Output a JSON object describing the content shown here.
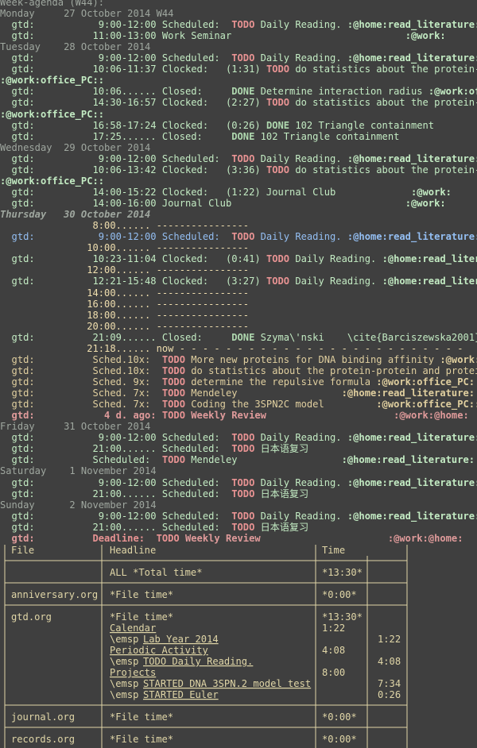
{
  "colors": {
    "background": "#3f3f3f",
    "default": "#dcdccc",
    "gray": "#9fa79f",
    "green": "#c3ebc3",
    "orange_todo": "#e89393",
    "done": "#afd8af",
    "time_pink": "#cc9393",
    "today_blue": "#94bff3",
    "deadline": "#e09b9b",
    "sched_past": "#e0cf9f",
    "line_yellow": "#f0dfaf",
    "table": "#e0d6a7"
  },
  "header": "Week-agenda (W44):",
  "lines": [
    {
      "segs": [
        {
          "t": "Monday     27 October 2014 W44",
          "c": "gray"
        }
      ]
    },
    {
      "segs": [
        {
          "t": "  gtd:           9:00-12:00 Scheduled:  ",
          "c": "green"
        },
        {
          "t": "TODO",
          "c": "orange_todo",
          "b": 1
        },
        {
          "t": " Daily Reading. ",
          "c": "green"
        },
        {
          "t": ":@home:read_literature:",
          "c": "green",
          "b": 1
        }
      ]
    },
    {
      "segs": [
        {
          "t": "  gtd:          11:00-13:00 Work Seminar                              ",
          "c": "green"
        },
        {
          "t": ":@work:",
          "c": "green",
          "b": 1
        }
      ]
    },
    {
      "segs": [
        {
          "t": "Tuesday    28 October 2014",
          "c": "gray"
        }
      ]
    },
    {
      "segs": [
        {
          "t": "  gtd:           9:00-12:00 Scheduled:  ",
          "c": "green"
        },
        {
          "t": "TODO",
          "c": "orange_todo",
          "b": 1
        },
        {
          "t": " Daily Reading. ",
          "c": "green"
        },
        {
          "t": ":@home:read_literature:",
          "c": "green",
          "b": 1
        }
      ]
    },
    {
      "segs": [
        {
          "t": "  gtd:          10:06-11:37 Clocked:   (1:31) ",
          "c": "green"
        },
        {
          "t": "TODO",
          "c": "orange_todo",
          "b": 1
        },
        {
          "t": " do statistics about the protein-prote",
          "c": "green"
        }
      ]
    },
    {
      "segs": [
        {
          "t": ":@work:office_PC::",
          "c": "green",
          "b": 1
        }
      ]
    },
    {
      "segs": [
        {
          "t": "  gtd:          10:06...... Closed:     ",
          "c": "green"
        },
        {
          "t": "DONE",
          "c": "done",
          "b": 1
        },
        {
          "t": " Determine interaction radius ",
          "c": "green"
        },
        {
          "t": ":@work:office_",
          "c": "green",
          "b": 1
        }
      ]
    },
    {
      "segs": [
        {
          "t": "  gtd:          14:30-16:57 Clocked:   (2:27) ",
          "c": "green"
        },
        {
          "t": "TODO",
          "c": "orange_todo",
          "b": 1
        },
        {
          "t": " do statistics about the protein-prote",
          "c": "green"
        }
      ]
    },
    {
      "segs": [
        {
          "t": ":@work:office_PC::",
          "c": "green",
          "b": 1
        }
      ]
    },
    {
      "segs": [
        {
          "t": "  gtd:          16:58-17:24 Clocked:   (0:26) ",
          "c": "green"
        },
        {
          "t": "DONE",
          "c": "done",
          "b": 1
        },
        {
          "t": " 102 Triangle containment",
          "c": "green"
        }
      ]
    },
    {
      "segs": [
        {
          "t": "  gtd:          17:25...... Closed:     ",
          "c": "green"
        },
        {
          "t": "DONE",
          "c": "done",
          "b": 1
        },
        {
          "t": " 102 Triangle containment",
          "c": "green"
        }
      ]
    },
    {
      "segs": [
        {
          "t": "Wednesday  29 October 2014",
          "c": "gray"
        }
      ]
    },
    {
      "segs": [
        {
          "t": "  gtd:           9:00-12:00 Scheduled:  ",
          "c": "green"
        },
        {
          "t": "TODO",
          "c": "orange_todo",
          "b": 1
        },
        {
          "t": " Daily Reading. ",
          "c": "green"
        },
        {
          "t": ":@home:read_literature:",
          "c": "green",
          "b": 1
        }
      ]
    },
    {
      "segs": [
        {
          "t": "  gtd:          10:06-13:42 Clocked:   (3:36) ",
          "c": "green"
        },
        {
          "t": "TODO",
          "c": "orange_todo",
          "b": 1
        },
        {
          "t": " do statistics about the protein-prote",
          "c": "green"
        }
      ]
    },
    {
      "segs": [
        {
          "t": ":@work:office_PC::",
          "c": "green",
          "b": 1
        }
      ]
    },
    {
      "segs": [
        {
          "t": "  gtd:          14:00-15:22 Clocked:   (1:22) Journal Club             ",
          "c": "green"
        },
        {
          "t": ":@work:",
          "c": "green",
          "b": 1
        }
      ]
    },
    {
      "segs": [
        {
          "t": "  gtd:          14:00-16:00 Journal Club                              ",
          "c": "green"
        },
        {
          "t": ":@work:",
          "c": "green",
          "b": 1
        }
      ]
    },
    {
      "segs": [
        {
          "t": "Thursday   30 October 2014",
          "c": "gray",
          "b": 1,
          "i": 1
        }
      ]
    },
    {
      "segs": [
        {
          "t": "                8:00...... ",
          "c": "line_yellow"
        },
        {
          "t": "----------------",
          "c": "line_yellow"
        }
      ]
    },
    {
      "segs": [
        {
          "t": "  gtd:           9:00-12:00 Scheduled:  ",
          "c": "today_blue"
        },
        {
          "t": "TODO",
          "c": "orange_todo",
          "b": 1
        },
        {
          "t": " Daily Reading. ",
          "c": "today_blue"
        },
        {
          "t": ":@home:read_literature:",
          "c": "today_blue",
          "b": 1
        }
      ]
    },
    {
      "segs": [
        {
          "t": "               10:00...... ----------------",
          "c": "line_yellow"
        }
      ]
    },
    {
      "segs": [
        {
          "t": "  gtd:          10:23-11:04 Clocked:   (0:41) ",
          "c": "green"
        },
        {
          "t": "TODO",
          "c": "orange_todo",
          "b": 1
        },
        {
          "t": " Daily Reading. ",
          "c": "green"
        },
        {
          "t": ":@home:read_literature",
          "c": "green",
          "b": 1
        }
      ]
    },
    {
      "segs": [
        {
          "t": "               12:00...... ----------------",
          "c": "line_yellow"
        }
      ]
    },
    {
      "segs": [
        {
          "t": "  gtd:          12:21-15:48 Clocked:   (3:27) ",
          "c": "green"
        },
        {
          "t": "TODO",
          "c": "orange_todo",
          "b": 1
        },
        {
          "t": " Daily Reading. ",
          "c": "green"
        },
        {
          "t": ":@home:read_literature",
          "c": "green",
          "b": 1
        }
      ]
    },
    {
      "segs": [
        {
          "t": "               14:00...... ----------------",
          "c": "line_yellow"
        }
      ]
    },
    {
      "segs": [
        {
          "t": "               16:00...... ----------------",
          "c": "line_yellow"
        }
      ]
    },
    {
      "segs": [
        {
          "t": "               18:00...... ----------------",
          "c": "line_yellow"
        }
      ]
    },
    {
      "segs": [
        {
          "t": "               20:00...... ----------------",
          "c": "line_yellow"
        }
      ]
    },
    {
      "segs": [
        {
          "t": "  gtd:          21:09...... Closed:     ",
          "c": "green"
        },
        {
          "t": "DONE",
          "c": "done",
          "b": 1
        },
        {
          "t": " Szyma\\'nski    \\cite{Barciszewska2001}",
          "c": "green"
        }
      ]
    },
    {
      "segs": [
        {
          "t": "               21:18...... now - - - - - - - - - - - - - - - - - - - - - - - - -",
          "c": "line_yellow"
        }
      ]
    },
    {
      "segs": [
        {
          "t": "  gtd:          Sched.10x:  ",
          "c": "sched_past"
        },
        {
          "t": "TODO",
          "c": "orange_todo",
          "b": 1
        },
        {
          "t": " More new proteins for DNA binding affinity ",
          "c": "sched_past"
        },
        {
          "t": ":@work:offic",
          "c": "sched_past",
          "b": 1
        }
      ]
    },
    {
      "segs": [
        {
          "t": "  gtd:          Sched.10x:  ",
          "c": "sched_past"
        },
        {
          "t": "TODO",
          "c": "orange_todo",
          "b": 1
        },
        {
          "t": " do statistics about the protein-protein and protein-DNA",
          "c": "sched_past"
        }
      ]
    },
    {
      "segs": [
        {
          "t": "  gtd:          Sched. 9x:  ",
          "c": "sched_past"
        },
        {
          "t": "TODO",
          "c": "orange_todo",
          "b": 1
        },
        {
          "t": " determine the repulsive formula ",
          "c": "sched_past"
        },
        {
          "t": ":@work:office_PC:",
          "c": "sched_past",
          "b": 1
        }
      ]
    },
    {
      "segs": [
        {
          "t": "  gtd:          Sched. 7x:  ",
          "c": "sched_past"
        },
        {
          "t": "TODO",
          "c": "orange_todo",
          "b": 1
        },
        {
          "t": " Mendeley                  ",
          "c": "sched_past"
        },
        {
          "t": ":@home:read_literature:",
          "c": "sched_past",
          "b": 1
        }
      ]
    },
    {
      "segs": [
        {
          "t": "  gtd:          Sched. 7x:  ",
          "c": "sched_past"
        },
        {
          "t": "TODO",
          "c": "orange_todo",
          "b": 1
        },
        {
          "t": " Coding the 3SPN2C model         ",
          "c": "sched_past"
        },
        {
          "t": ":@work:office_PC::",
          "c": "sched_past",
          "b": 1
        }
      ]
    },
    {
      "segs": [
        {
          "t": "  gtd:            4 d. ago: ",
          "c": "deadline",
          "b": 1
        },
        {
          "t": "TODO",
          "c": "orange_todo",
          "b": 1
        },
        {
          "t": " Weekly Review                      ",
          "c": "deadline",
          "b": 1
        },
        {
          "t": ":@work:@home:",
          "c": "deadline",
          "b": 1
        }
      ]
    },
    {
      "segs": [
        {
          "t": "Friday     31 October 2014",
          "c": "gray"
        }
      ]
    },
    {
      "segs": [
        {
          "t": "  gtd:           9:00-12:00 Scheduled:  ",
          "c": "green"
        },
        {
          "t": "TODO",
          "c": "orange_todo",
          "b": 1
        },
        {
          "t": " Daily Reading. ",
          "c": "green"
        },
        {
          "t": ":@home:read_literature:",
          "c": "green",
          "b": 1
        }
      ]
    },
    {
      "segs": [
        {
          "t": "  gtd:          21:00...... Scheduled:  ",
          "c": "green"
        },
        {
          "t": "TODO",
          "c": "orange_todo",
          "b": 1
        },
        {
          "t": " 日本语复习",
          "c": "green"
        }
      ]
    },
    {
      "segs": [
        {
          "t": "  gtd:          Scheduled:  ",
          "c": "green"
        },
        {
          "t": "TODO",
          "c": "orange_todo",
          "b": 1
        },
        {
          "t": " Mendeley                  ",
          "c": "green"
        },
        {
          "t": ":@home:read_literature:",
          "c": "green",
          "b": 1
        }
      ]
    },
    {
      "segs": [
        {
          "t": "Saturday    1 November 2014",
          "c": "gray"
        }
      ]
    },
    {
      "segs": [
        {
          "t": "  gtd:           9:00-12:00 Scheduled:  ",
          "c": "green"
        },
        {
          "t": "TODO",
          "c": "orange_todo",
          "b": 1
        },
        {
          "t": " Daily Reading. ",
          "c": "green"
        },
        {
          "t": ":@home:read_literature:",
          "c": "green",
          "b": 1
        }
      ]
    },
    {
      "segs": [
        {
          "t": "  gtd:          21:00...... Scheduled:  ",
          "c": "green"
        },
        {
          "t": "TODO",
          "c": "orange_todo",
          "b": 1
        },
        {
          "t": " 日本语复习",
          "c": "green"
        }
      ]
    },
    {
      "segs": [
        {
          "t": "Sunday      2 November 2014",
          "c": "gray"
        }
      ]
    },
    {
      "segs": [
        {
          "t": "  gtd:           9:00-12:00 Scheduled:  ",
          "c": "green"
        },
        {
          "t": "TODO",
          "c": "orange_todo",
          "b": 1
        },
        {
          "t": " Daily Reading. ",
          "c": "green"
        },
        {
          "t": ":@home:read_literature:",
          "c": "green",
          "b": 1
        }
      ]
    },
    {
      "segs": [
        {
          "t": "  gtd:          21:00...... Scheduled:  ",
          "c": "green"
        },
        {
          "t": "TODO",
          "c": "orange_todo",
          "b": 1
        },
        {
          "t": " 日本语复习",
          "c": "green"
        }
      ]
    },
    {
      "segs": [
        {
          "t": "  gtd:          ",
          "c": "deadline",
          "b": 1
        },
        {
          "t": "Deadline:  ",
          "c": "orange_todo",
          "b": 1
        },
        {
          "t": "TODO",
          "c": "orange_todo",
          "b": 1
        },
        {
          "t": " Weekly Review                      ",
          "c": "deadline",
          "b": 1
        },
        {
          "t": ":@work:@home:",
          "c": "deadline",
          "b": 1
        }
      ]
    }
  ],
  "clocktable": {
    "headers": [
      "File",
      "Headline",
      "Time",
      ""
    ],
    "total": {
      "headline": "ALL *Total time*",
      "time": "*13:30*"
    },
    "sections": [
      {
        "file": "anniversary.org",
        "rows": [
          {
            "h": "*File time*",
            "t1": "*0:00*",
            "t2": ""
          }
        ]
      },
      {
        "file": "gtd.org",
        "rows": [
          {
            "h": "*File time*",
            "t1": "*13:30*",
            "t2": ""
          },
          {
            "h": "Calendar",
            "link": true,
            "t1": "1:22",
            "t2": ""
          },
          {
            "h": "\\emsp ",
            "hl": "Lab Year 2014",
            "t1": "",
            "t2": "1:22"
          },
          {
            "h": "Periodic Activity",
            "link": true,
            "t1": "4:08",
            "t2": ""
          },
          {
            "h": "\\emsp ",
            "hl": "TODO Daily Reading.",
            "t1": "",
            "t2": "4:08"
          },
          {
            "h": "Projects",
            "link": true,
            "t1": "8:00",
            "t2": ""
          },
          {
            "h": "\\emsp ",
            "hl": "STARTED DNA 3SPN.2 model test",
            "t1": "",
            "t2": "7:34"
          },
          {
            "h": "\\emsp ",
            "hl": "STARTED Euler",
            "t1": "",
            "t2": "0:26"
          }
        ]
      },
      {
        "file": "journal.org",
        "rows": [
          {
            "h": "*File time*",
            "t1": "*0:00*",
            "t2": ""
          }
        ]
      },
      {
        "file": "records.org",
        "rows": [
          {
            "h": "*File time*",
            "t1": "*0:00*",
            "t2": ""
          }
        ]
      }
    ]
  }
}
